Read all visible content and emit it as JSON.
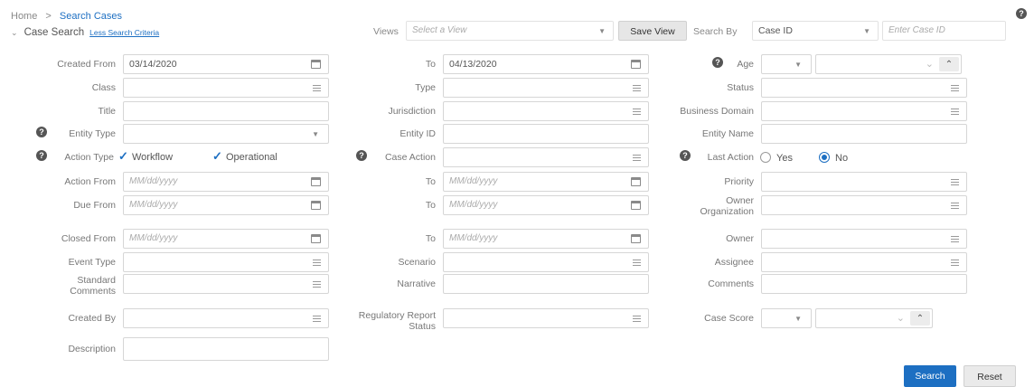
{
  "breadcrumb": {
    "home": "Home",
    "separator": ">",
    "current": "Search Cases"
  },
  "section": {
    "title": "Case Search",
    "toggle_link": "Less Search Criteria"
  },
  "toolbar": {
    "views_label": "Views",
    "views_placeholder": "Select a View",
    "save_view": "Save View",
    "search_by_label": "Search By",
    "search_by_value": "Case ID",
    "case_id_placeholder": "Enter Case ID"
  },
  "labels": {
    "created_from": "Created From",
    "to": "To",
    "age": "Age",
    "class": "Class",
    "type": "Type",
    "status": "Status",
    "title": "Title",
    "jurisdiction": "Jurisdiction",
    "business_domain": "Business Domain",
    "entity_type": "Entity Type",
    "entity_id": "Entity ID",
    "entity_name": "Entity Name",
    "action_type": "Action Type",
    "case_action": "Case Action",
    "last_action": "Last Action",
    "action_from": "Action From",
    "priority": "Priority",
    "due_from": "Due From",
    "owner_org_1": "Owner",
    "owner_org_2": "Organization",
    "closed_from": "Closed From",
    "owner": "Owner",
    "event_type": "Event Type",
    "scenario": "Scenario",
    "assignee": "Assignee",
    "standard_comments_1": "Standard",
    "standard_comments_2": "Comments",
    "narrative": "Narrative",
    "comments": "Comments",
    "created_by": "Created By",
    "reg_report_status_1": "Regulatory Report",
    "reg_report_status_2": "Status",
    "case_score": "Case Score",
    "description": "Description"
  },
  "values": {
    "created_from": "03/14/2020",
    "created_to": "04/13/2020",
    "date_placeholder": "MM/dd/yyyy"
  },
  "options": {
    "workflow": "Workflow",
    "operational": "Operational",
    "yes": "Yes",
    "no": "No"
  },
  "buttons": {
    "search": "Search",
    "reset": "Reset"
  },
  "icons": {
    "help": "help-circle-icon",
    "calendar": "calendar-icon",
    "list": "list-icon",
    "caret": "chevron-down-icon",
    "check": "checkmark-icon"
  },
  "colors": {
    "accent": "#1d6fc2",
    "link": "#1d6fc2",
    "label": "#777777",
    "border": "#d6d6d6"
  }
}
